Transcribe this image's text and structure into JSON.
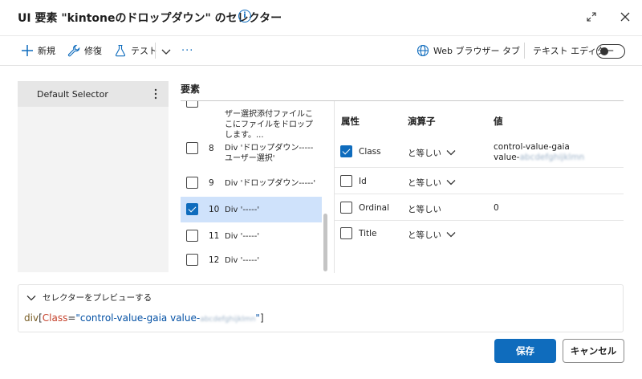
{
  "window": {
    "title": "UI 要素 \"kintoneのドロップダウン\" のセレクター",
    "info_icon": "info-icon",
    "expand_icon": "expand-icon",
    "close_icon": "close-icon"
  },
  "toolbar": {
    "new_label": "新規",
    "repair_label": "修復",
    "test_label": "テスト",
    "more_label": "···",
    "browser_tab_label": "Web ブラウザー タブ",
    "text_editor_label": "テキスト エディター",
    "text_editor_on": false
  },
  "left_panel": {
    "items": [
      {
        "label": "Default Selector",
        "selected": true
      }
    ]
  },
  "elements": {
    "header": "要素",
    "rows": [
      {
        "num": "",
        "text": "ザー選択添付ファイルここにファイルをドロップします。...",
        "checked": false,
        "selected": false
      },
      {
        "num": "8",
        "text": "Div 'ドロップダウン-----ユーザー選択'",
        "checked": false,
        "selected": false
      },
      {
        "num": "9",
        "text": "Div 'ドロップダウン-----'",
        "checked": false,
        "selected": false
      },
      {
        "num": "10",
        "text": "Div '-----'",
        "checked": true,
        "selected": true
      },
      {
        "num": "11",
        "text": "Div '-----'",
        "checked": false,
        "selected": false
      },
      {
        "num": "12",
        "text": "Div '-----'",
        "checked": false,
        "selected": false
      }
    ]
  },
  "attributes": {
    "columns": {
      "attribute": "属性",
      "operator": "演算子",
      "value": "値"
    },
    "rows": [
      {
        "name": "Class",
        "checked": true,
        "operator": "と等しい",
        "has_dropdown": true,
        "value_line1": "control-value-gaia",
        "value_line2": "value-",
        "value_blurred": "abcdefghijklmn"
      },
      {
        "name": "Id",
        "checked": false,
        "operator": "と等しい",
        "has_dropdown": true,
        "value_line1": "",
        "value_line2": "",
        "value_blurred": ""
      },
      {
        "name": "Ordinal",
        "checked": false,
        "operator": "と等しい",
        "has_dropdown": false,
        "value_line1": "0",
        "value_line2": "",
        "value_blurred": ""
      },
      {
        "name": "Title",
        "checked": false,
        "operator": "と等しい",
        "has_dropdown": true,
        "value_line1": "",
        "value_line2": "",
        "value_blurred": ""
      }
    ]
  },
  "preview": {
    "label": "セレクターをプレビューする",
    "code_tag": "div",
    "code_open": "[",
    "code_attr": "Class",
    "code_eq": "=",
    "code_value": "\"control-value-gaia value-",
    "code_value_blurred": "abcdefghijklmn",
    "code_value_end": "\"",
    "code_close": "]"
  },
  "buttons": {
    "save": "保存",
    "cancel": "キャンセル"
  },
  "colors": {
    "accent": "#0f6cbd",
    "selected_row": "#cfe2fb"
  }
}
